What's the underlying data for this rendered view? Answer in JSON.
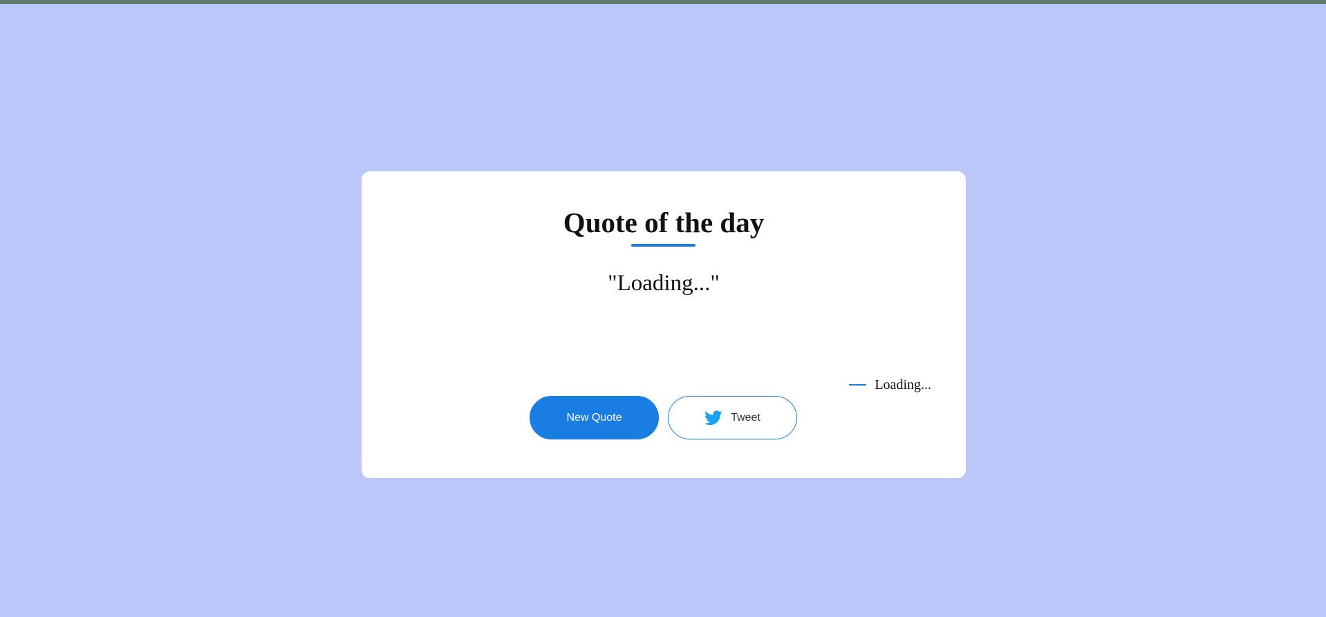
{
  "card": {
    "title": "Quote of the day",
    "quote_text": "\"Loading...\"",
    "author": "Loading..."
  },
  "actions": {
    "new_quote_label": "New Quote",
    "tweet_label": "Tweet",
    "tweet_icon": "twitter-bird-icon"
  },
  "colors": {
    "background": "#bbc6f9",
    "accent": "#1a7de2",
    "twitter_blue": "#1da1f2",
    "card": "#ffffff"
  }
}
